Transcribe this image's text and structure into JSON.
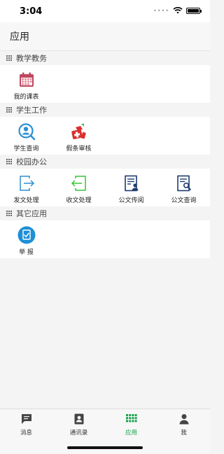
{
  "status": {
    "time": "3:04"
  },
  "header": {
    "title": "应用"
  },
  "sections": [
    {
      "title": "教学教务",
      "items": [
        {
          "label": "我的课表",
          "icon": "calendar-icon"
        }
      ]
    },
    {
      "title": "学生工作",
      "items": [
        {
          "label": "学生查询",
          "icon": "person-search-icon"
        },
        {
          "label": "假条审核",
          "icon": "medical-leave-icon"
        }
      ]
    },
    {
      "title": "校园办公",
      "items": [
        {
          "label": "发文处理",
          "icon": "send-document-icon"
        },
        {
          "label": "收文处理",
          "icon": "receive-document-icon"
        },
        {
          "label": "公文传阅",
          "icon": "document-circulate-icon"
        },
        {
          "label": "公文查询",
          "icon": "document-search-icon"
        }
      ]
    },
    {
      "title": "其它应用",
      "items": [
        {
          "label": "举 报",
          "icon": "report-icon"
        }
      ]
    }
  ],
  "tabbar": {
    "items": [
      {
        "label": "消息",
        "icon": "message-icon"
      },
      {
        "label": "通讯录",
        "icon": "contacts-icon"
      },
      {
        "label": "应用",
        "icon": "apps-grid-icon",
        "active": true
      },
      {
        "label": "我",
        "icon": "person-icon"
      }
    ]
  },
  "colors": {
    "accent": "#16a34a",
    "calendar": "#c0475f",
    "search_blue": "#2a8fd4",
    "leave_red": "#d9302f",
    "send_blue": "#2a8fd4",
    "receive_green": "#3ac43a",
    "doc_navy": "#1d3b6e",
    "report_blue": "#1f8fd6"
  }
}
